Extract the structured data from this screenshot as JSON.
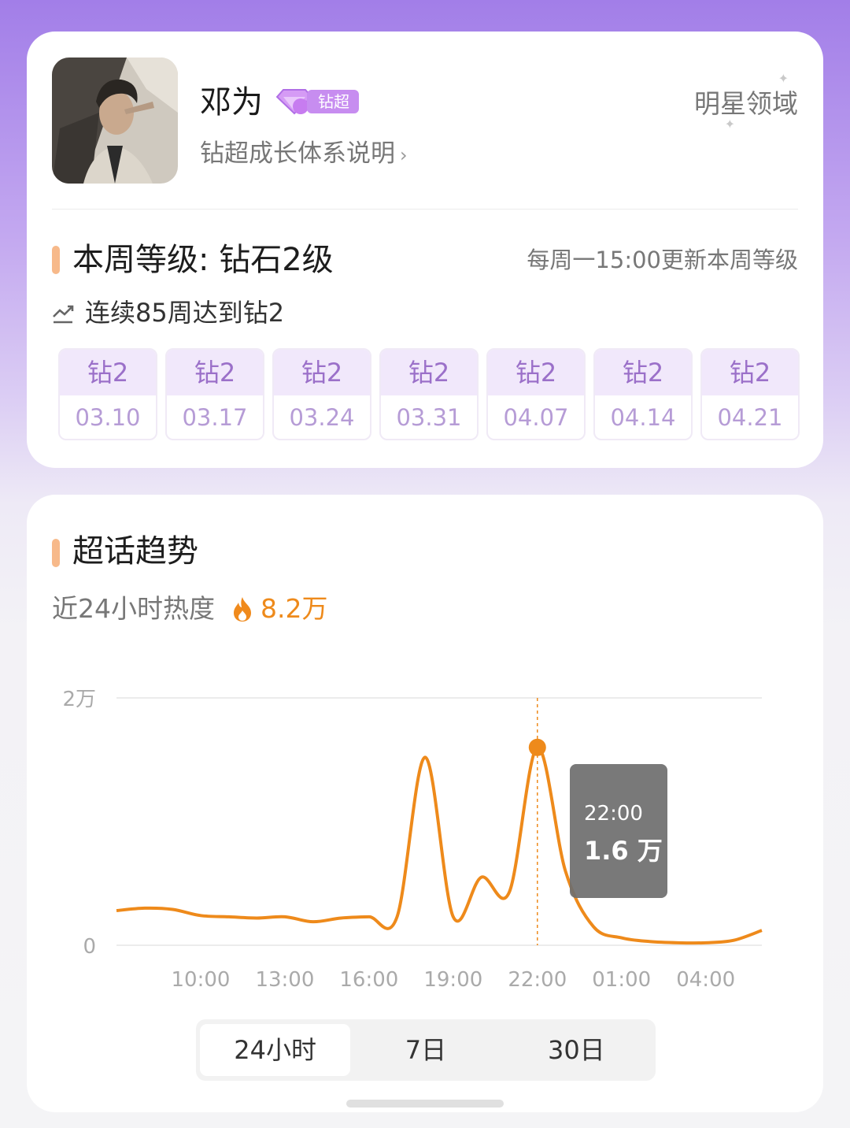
{
  "profile": {
    "name": "邓为",
    "badge_label": "钻超",
    "badge_level": "2",
    "growth_link": "钻超成长体系说明",
    "domain_label": "明星领域"
  },
  "level": {
    "title": "本周等级: 钻石2级",
    "update_note": "每周一15:00更新本周等级",
    "streak": "连续85周达到钻2",
    "weeks": [
      {
        "level": "钻2",
        "date": "03.10"
      },
      {
        "level": "钻2",
        "date": "03.17"
      },
      {
        "level": "钻2",
        "date": "03.24"
      },
      {
        "level": "钻2",
        "date": "03.31"
      },
      {
        "level": "钻2",
        "date": "04.07"
      },
      {
        "level": "钻2",
        "date": "04.14"
      },
      {
        "level": "钻2",
        "date": "04.21"
      }
    ]
  },
  "trend": {
    "title": "超话趋势",
    "heat_label": "近24小时热度",
    "heat_value": "8.2万",
    "tooltip": {
      "time": "22:00",
      "value": "1.6 万"
    },
    "tabs": [
      {
        "label": "24小时",
        "active": true
      },
      {
        "label": "7日",
        "active": false
      },
      {
        "label": "30日",
        "active": false
      }
    ]
  },
  "chart_data": {
    "type": "line",
    "x": [
      "07:00",
      "08:00",
      "09:00",
      "10:00",
      "11:00",
      "12:00",
      "13:00",
      "14:00",
      "15:00",
      "16:00",
      "17:00",
      "18:00",
      "19:00",
      "20:00",
      "21:00",
      "22:00",
      "23:00",
      "00:00",
      "01:00",
      "02:00",
      "03:00",
      "04:00",
      "05:00",
      "06:00"
    ],
    "y": [
      2800,
      3000,
      2900,
      2400,
      2300,
      2200,
      2300,
      1900,
      2200,
      2300,
      2300,
      15200,
      2300,
      5500,
      4300,
      16000,
      6000,
      1500,
      600,
      300,
      200,
      200,
      400,
      1200
    ],
    "xticks": [
      "10:00",
      "13:00",
      "16:00",
      "19:00",
      "22:00",
      "01:00",
      "04:00"
    ],
    "ytick_labels": [
      "0",
      "2万"
    ],
    "ylim": [
      0,
      20000
    ],
    "highlight_x": "22:00",
    "line_color": "#ee8a1b"
  }
}
